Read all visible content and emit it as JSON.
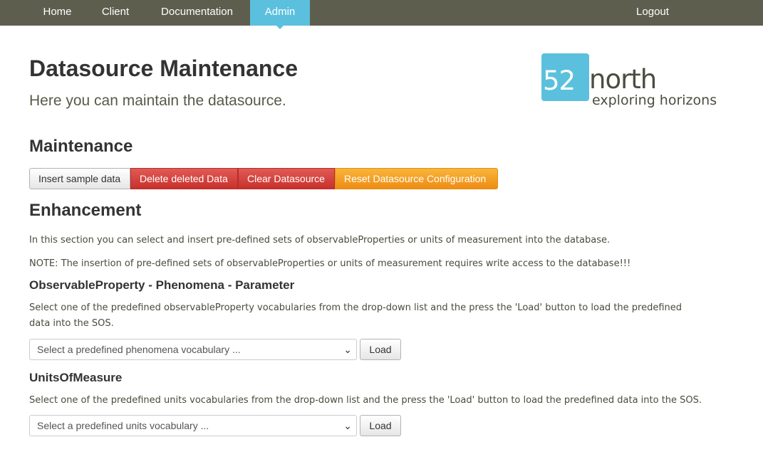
{
  "nav": {
    "home": "Home",
    "client": "Client",
    "documentation": "Documentation",
    "admin": "Admin",
    "logout": "Logout",
    "active_color": "#5bc0de",
    "bar_color": "#5e5e4f"
  },
  "page": {
    "title": "Datasource Maintenance",
    "lead": "Here you can maintain the datasource."
  },
  "logo": {
    "number": "52",
    "word": "north",
    "tagline": "exploring horizons"
  },
  "maintenance": {
    "title": "Maintenance",
    "buttons": {
      "insert": "Insert sample data",
      "delete": "Delete deleted Data",
      "clear": "Clear Datasource",
      "reset": "Reset Datasource Configuration"
    }
  },
  "enhancement": {
    "title": "Enhancement",
    "intro": "In this section you can select and insert pre-defined sets of observableProperties or units of measurement into the database.",
    "note": "NOTE: The insertion of pre-defined sets of observableProperties or units of measurement requires write access to the database!!!",
    "observable": {
      "title": "ObservableProperty - Phenomena - Parameter",
      "description": "Select one of the predefined observableProperty vocabularies from the drop-down list and the press the 'Load' button to load the predefined data into the SOS.",
      "select_value": "Select a predefined phenomena vocabulary ...",
      "load": "Load"
    },
    "units": {
      "title": "UnitsOfMeasure",
      "description": "Select one of the predefined units vocabularies from the drop-down list and the press the 'Load' button to load the predefined data into the SOS.",
      "select_value": "Select a predefined units vocabulary ...",
      "load": "Load"
    }
  }
}
